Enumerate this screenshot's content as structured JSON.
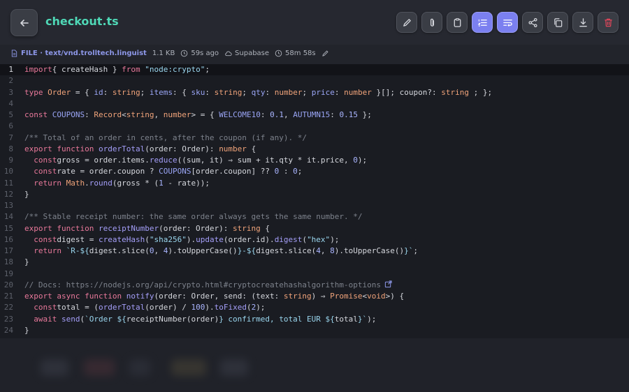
{
  "header": {
    "title": "checkout.ts",
    "toolbar": [
      {
        "icon": "pencil-icon",
        "active": false
      },
      {
        "icon": "paperclip-icon",
        "active": false
      },
      {
        "icon": "clipboard-icon",
        "active": false
      },
      {
        "icon": "numbered-list-icon",
        "active": true
      },
      {
        "icon": "wrap-text-icon",
        "active": true
      },
      {
        "icon": "share-icon",
        "active": false
      },
      {
        "icon": "copy-icon",
        "active": false
      },
      {
        "icon": "download-icon",
        "active": false
      },
      {
        "icon": "trash-icon",
        "active": false
      }
    ]
  },
  "meta": {
    "kind": "FILE · text/vnd.trolltech.linguist",
    "size": "1.1 KB",
    "age": "59s ago",
    "storage": "Supabase",
    "expires": "58m 58s"
  },
  "editor": {
    "current_line": 1,
    "line_numbers": [
      "1",
      "2",
      "3",
      "4",
      "5",
      "6",
      "7",
      "8",
      "9",
      "10",
      "11",
      "12",
      "13",
      "14",
      "15",
      "16",
      "17",
      "18",
      "19",
      "20",
      "21",
      "22",
      "23",
      "24"
    ],
    "lines": [
      [
        [
          "kw",
          "import"
        ],
        [
          "",
          "{ createHash } "
        ],
        [
          "kw",
          "from"
        ],
        [
          "",
          ""
        ],
        [
          "st",
          "\"node:crypto\""
        ],
        [
          "",
          ";"
        ]
      ],
      [],
      [
        [
          "kw",
          "type"
        ],
        [
          "",
          ""
        ],
        [
          "ty",
          "Order"
        ],
        [
          "",
          " = { "
        ],
        [
          "pr",
          "id"
        ],
        [
          "",
          ": "
        ],
        [
          "ty",
          "string"
        ],
        [
          "",
          "; "
        ],
        [
          "pr",
          "items"
        ],
        [
          "",
          ": { "
        ],
        [
          "pr",
          "sku"
        ],
        [
          "",
          ": "
        ],
        [
          "ty",
          "string"
        ],
        [
          "",
          "; "
        ],
        [
          "pr",
          "qty"
        ],
        [
          "",
          ": "
        ],
        [
          "ty",
          "number"
        ],
        [
          "",
          "; "
        ],
        [
          "pr",
          "price"
        ],
        [
          "",
          ": "
        ],
        [
          "ty",
          "number"
        ],
        [
          "",
          ""
        ],
        [
          "",
          "}[]; coupon?: "
        ],
        [
          "ty",
          "string"
        ],
        [
          "",
          ""
        ],
        [
          "",
          ";"
        ],
        [
          "",
          ""
        ],
        [
          "",
          "};"
        ]
      ],
      [],
      [
        [
          "kw",
          "const"
        ],
        [
          "",
          ""
        ],
        [
          "pr",
          "COUPONS"
        ],
        [
          "",
          ": "
        ],
        [
          "ty",
          "Record"
        ],
        [
          "",
          "<"
        ],
        [
          "ty",
          "string"
        ],
        [
          "",
          ", "
        ],
        [
          "ty",
          "number"
        ],
        [
          "",
          "> = { "
        ],
        [
          "pr",
          "WELCOME10"
        ],
        [
          "",
          ": "
        ],
        [
          "nu",
          "0.1"
        ],
        [
          "",
          ", "
        ],
        [
          "pr",
          "AUTUMN15"
        ],
        [
          "",
          ": "
        ],
        [
          "nu",
          "0.15"
        ],
        [
          "",
          ""
        ],
        [
          "",
          "};"
        ]
      ],
      [],
      [
        [
          "cm",
          "/** Total of an order in cents, after the coupon (if any). */"
        ]
      ],
      [
        [
          "kw",
          "export"
        ],
        [
          "",
          ""
        ],
        [
          "kw",
          "function"
        ],
        [
          "",
          ""
        ],
        [
          "fn",
          "orderTotal"
        ],
        [
          "",
          "(order: Order): "
        ],
        [
          "ty",
          "number"
        ],
        [
          "",
          ""
        ],
        [
          "",
          "{"
        ]
      ],
      [
        [
          "",
          "  "
        ],
        [
          "kw",
          "const"
        ],
        [
          "",
          "gross = order.items."
        ],
        [
          "fn",
          "reduce"
        ],
        [
          "",
          "((sum, it) ⇒ sum + it.qty * it.price, "
        ],
        [
          "nu",
          "0"
        ],
        [
          "",
          "); "
        ]
      ],
      [
        [
          "",
          "  "
        ],
        [
          "kw",
          "const"
        ],
        [
          "",
          "rate = order.coupon ? "
        ],
        [
          "pr",
          "COUPONS"
        ],
        [
          "",
          "[order.coupon] ?? "
        ],
        [
          "nu",
          "0"
        ],
        [
          "",
          ""
        ],
        [
          "",
          ":"
        ],
        [
          "",
          ""
        ],
        [
          "nu",
          "0"
        ],
        [
          "",
          ";"
        ]
      ],
      [
        [
          "",
          "  "
        ],
        [
          "kw",
          "return"
        ],
        [
          "",
          ""
        ],
        [
          "ty",
          "Math"
        ],
        [
          "",
          "."
        ],
        [
          "fn",
          "round"
        ],
        [
          "",
          "(gross * ("
        ],
        [
          "nu",
          "1"
        ],
        [
          "",
          ""
        ],
        [
          "",
          "- rate));"
        ]
      ],
      [
        [
          "",
          "}"
        ]
      ],
      [],
      [
        [
          "cm",
          "/** Stable receipt number: the same order always gets the same number. */"
        ]
      ],
      [
        [
          "kw",
          "export"
        ],
        [
          "",
          ""
        ],
        [
          "kw",
          "function"
        ],
        [
          "",
          ""
        ],
        [
          "fn",
          "receiptNumber"
        ],
        [
          "",
          "(order: Order): "
        ],
        [
          "ty",
          "string"
        ],
        [
          "",
          ""
        ],
        [
          "",
          "{"
        ]
      ],
      [
        [
          "",
          "  "
        ],
        [
          "kw",
          "const"
        ],
        [
          "",
          "digest = "
        ],
        [
          "fn",
          "createHash"
        ],
        [
          "",
          "("
        ],
        [
          "st",
          "\"sha256\""
        ],
        [
          "",
          ")."
        ],
        [
          "fn",
          "update"
        ],
        [
          "",
          "(order.id)."
        ],
        [
          "fn",
          "digest"
        ],
        [
          "",
          "("
        ],
        [
          "st",
          "\"hex\""
        ],
        [
          "",
          ");"
        ]
      ],
      [
        [
          "",
          "  "
        ],
        [
          "kw",
          "return"
        ],
        [
          "",
          ""
        ],
        [
          "st",
          "`R-${"
        ],
        [
          "",
          "digest.slice("
        ],
        [
          "nu",
          "0"
        ],
        [
          "",
          ", "
        ],
        [
          "nu",
          "4"
        ],
        [
          "",
          ").toUpperCase()"
        ],
        [
          "st",
          "}-${"
        ],
        [
          "",
          "digest.slice("
        ],
        [
          "nu",
          "4"
        ],
        [
          "",
          ", "
        ],
        [
          "nu",
          "8"
        ],
        [
          "",
          ").toUpperCase()"
        ],
        [
          "st",
          "}`"
        ],
        [
          "",
          ";"
        ]
      ],
      [
        [
          "",
          "}"
        ]
      ],
      [],
      [
        [
          "cm",
          "// Docs: https://nodejs.org/api/crypto.html#cryptocreatehashalgorithm-options"
        ]
      ],
      [
        [
          "kw",
          "export"
        ],
        [
          "",
          ""
        ],
        [
          "kw",
          "async"
        ],
        [
          "",
          ""
        ],
        [
          "kw",
          "function"
        ],
        [
          "",
          ""
        ],
        [
          "fn",
          "notify"
        ],
        [
          "",
          "(order: Order, send: (text: "
        ],
        [
          "ty",
          "string"
        ],
        [
          "",
          ") ⇒ "
        ],
        [
          "ty",
          "Promise"
        ],
        [
          "",
          "<"
        ],
        [
          "ty",
          "void"
        ],
        [
          "",
          ">) {"
        ]
      ],
      [
        [
          "",
          "  "
        ],
        [
          "kw",
          "const"
        ],
        [
          "",
          "total = ("
        ],
        [
          "fn",
          "orderTotal"
        ],
        [
          "",
          "(order) / "
        ],
        [
          "nu",
          "100"
        ],
        [
          "",
          ")."
        ],
        [
          "fn",
          "toFixed"
        ],
        [
          "",
          "("
        ],
        [
          "nu",
          "2"
        ],
        [
          "",
          ");"
        ]
      ],
      [
        [
          "",
          "  "
        ],
        [
          "kw",
          "await"
        ],
        [
          "",
          ""
        ],
        [
          "fn",
          "send"
        ],
        [
          "",
          "("
        ],
        [
          "st",
          "`Order ${"
        ],
        [
          "",
          "receiptNumber(order)"
        ],
        [
          "st",
          "} confirmed, total EUR ${"
        ],
        [
          "",
          "total"
        ],
        [
          "st",
          "}`"
        ],
        [
          "",
          ");"
        ]
      ],
      [
        [
          "",
          "}"
        ]
      ]
    ]
  },
  "colors": {
    "accent": "#4fd8b6",
    "active_button": "#7b80f0",
    "danger": "#e0465a"
  }
}
